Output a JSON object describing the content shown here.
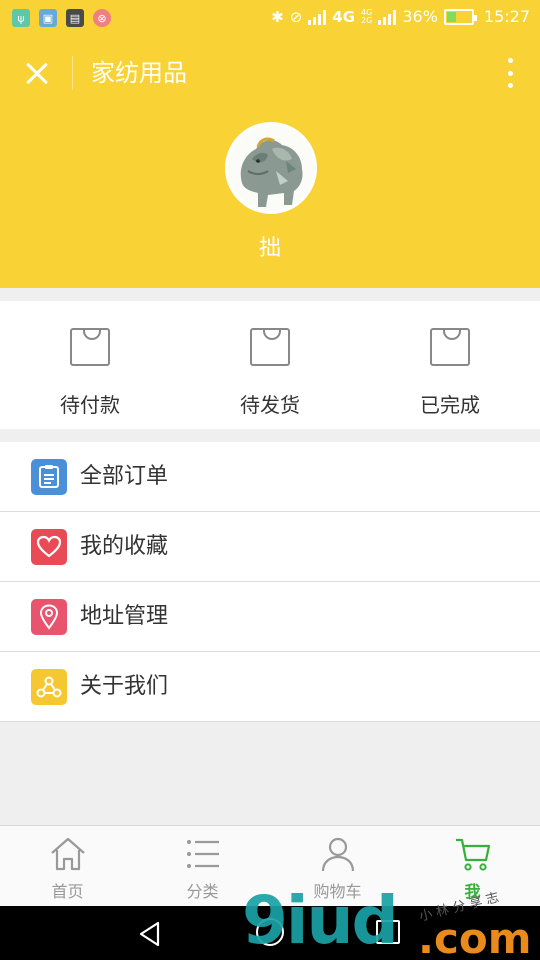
{
  "status_bar": {
    "network": "4G",
    "network2": "4G",
    "network3": "2G",
    "battery": "36%",
    "battery_level": 0.36,
    "time": "15:27",
    "colors": {
      "background": "#f9d335",
      "battery_fill": "#7dde5a"
    }
  },
  "header": {
    "title": "家纺用品",
    "username": "拙",
    "background": "#f9d335"
  },
  "orders": [
    {
      "label": "待付款",
      "icon": "shopping-bag-icon"
    },
    {
      "label": "待发货",
      "icon": "shopping-bag-icon"
    },
    {
      "label": "已完成",
      "icon": "shopping-bag-icon"
    }
  ],
  "menu": [
    {
      "label": "全部订单",
      "icon": "order-list-icon",
      "color": "#4a90d9"
    },
    {
      "label": "我的收藏",
      "icon": "heart-icon",
      "color": "#e84b55"
    },
    {
      "label": "地址管理",
      "icon": "location-pin-icon",
      "color": "#e8546e"
    },
    {
      "label": "关于我们",
      "icon": "about-icon",
      "color": "#f5c832"
    }
  ],
  "tabbar": [
    {
      "label": "首页",
      "icon": "home-icon",
      "active": false
    },
    {
      "label": "分类",
      "icon": "category-list-icon",
      "active": false
    },
    {
      "label": "购物车",
      "icon": "user-icon",
      "active": false
    },
    {
      "label": "我",
      "icon": "cart-icon",
      "active": true
    }
  ],
  "tab_active_color": "#36b03b",
  "watermark": {
    "logo": "9iud",
    "suffix": ".com",
    "small": "小 林 分 享 志"
  }
}
